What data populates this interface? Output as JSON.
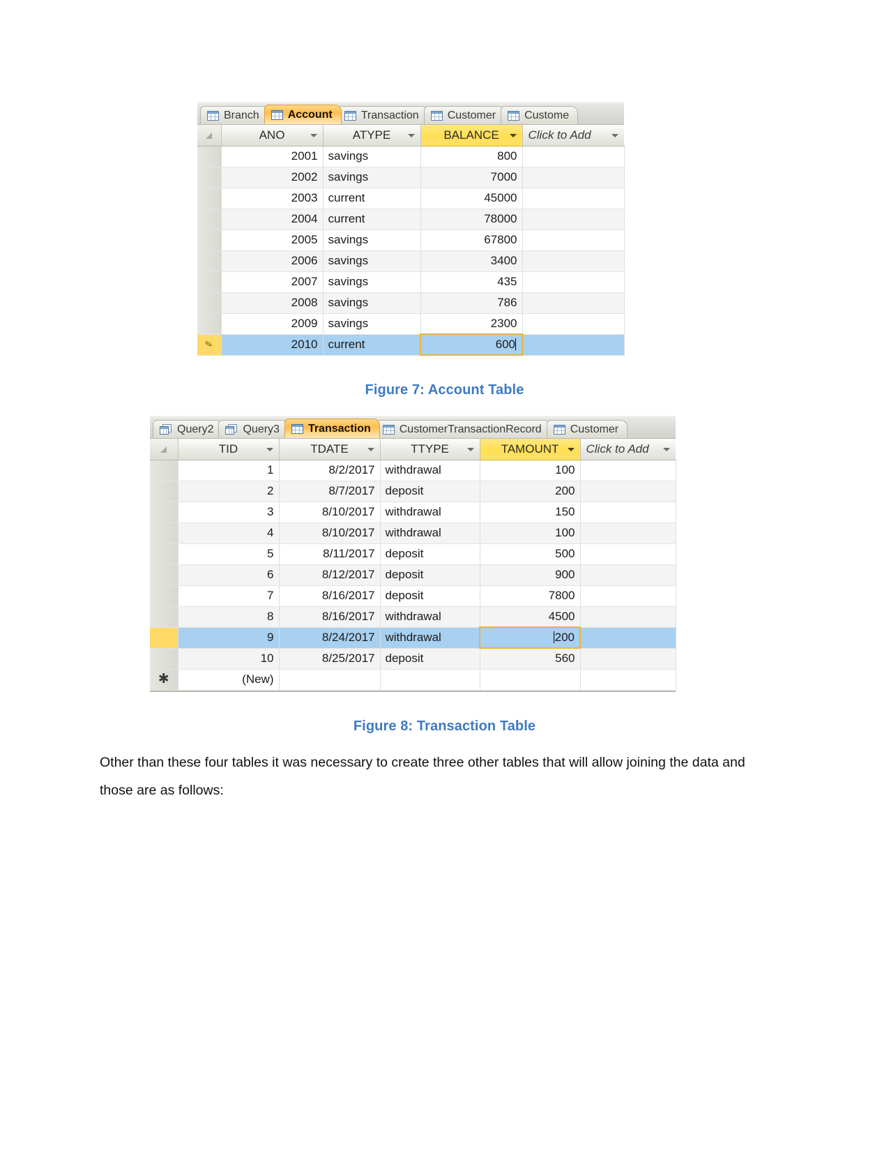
{
  "document": {
    "figure7_caption": "Figure 7: Account Table",
    "figure8_caption": "Figure 8: Transaction Table",
    "paragraph": "Other than these four tables it was necessary to create three other tables that will allow joining the data and those are as follows:",
    "caption_color": "#3f7ac0"
  },
  "account_screenshot": {
    "tabs": [
      {
        "label": "Branch",
        "icon": "table-icon",
        "active": false
      },
      {
        "label": "Account",
        "icon": "table-icon",
        "active": true
      },
      {
        "label": "Transaction",
        "icon": "table-icon",
        "active": false
      },
      {
        "label": "Customer",
        "icon": "table-icon",
        "active": false
      },
      {
        "label": "Custome",
        "icon": "table-icon",
        "active": false
      }
    ],
    "columns": [
      "ANO",
      "ATYPE",
      "BALANCE"
    ],
    "highlighted_column": "BALANCE",
    "add_column_label": "Click to Add",
    "rows": [
      {
        "ANO": "2001",
        "ATYPE": "savings",
        "BALANCE": "800"
      },
      {
        "ANO": "2002",
        "ATYPE": "savings",
        "BALANCE": "7000"
      },
      {
        "ANO": "2003",
        "ATYPE": "current",
        "BALANCE": "45000"
      },
      {
        "ANO": "2004",
        "ATYPE": "current",
        "BALANCE": "78000"
      },
      {
        "ANO": "2005",
        "ATYPE": "savings",
        "BALANCE": "67800"
      },
      {
        "ANO": "2006",
        "ATYPE": "savings",
        "BALANCE": "3400"
      },
      {
        "ANO": "2007",
        "ATYPE": "savings",
        "BALANCE": "435"
      },
      {
        "ANO": "2008",
        "ATYPE": "savings",
        "BALANCE": "786"
      },
      {
        "ANO": "2009",
        "ATYPE": "savings",
        "BALANCE": "2300"
      },
      {
        "ANO": "2010",
        "ATYPE": "current",
        "BALANCE": "600"
      }
    ],
    "selected_row_index": 9,
    "editing_cell": {
      "row": 9,
      "column": "BALANCE",
      "value": "600"
    },
    "record_indicator": "pencil-icon"
  },
  "transaction_screenshot": {
    "tabs": [
      {
        "label": "Query2",
        "icon": "query-icon",
        "active": false
      },
      {
        "label": "Query3",
        "icon": "query-icon",
        "active": false
      },
      {
        "label": "Transaction",
        "icon": "table-icon",
        "active": true
      },
      {
        "label": "CustomerTransactionRecord",
        "icon": "table-icon",
        "active": false
      },
      {
        "label": "Customer",
        "icon": "table-icon",
        "active": false
      }
    ],
    "columns": [
      "TID",
      "TDATE",
      "TTYPE",
      "TAMOUNT"
    ],
    "highlighted_column": "TAMOUNT",
    "add_column_label": "Click to Add",
    "new_row_label": "(New)",
    "rows": [
      {
        "TID": "1",
        "TDATE": "8/2/2017",
        "TTYPE": "withdrawal",
        "TAMOUNT": "100"
      },
      {
        "TID": "2",
        "TDATE": "8/7/2017",
        "TTYPE": "deposit",
        "TAMOUNT": "200"
      },
      {
        "TID": "3",
        "TDATE": "8/10/2017",
        "TTYPE": "withdrawal",
        "TAMOUNT": "150"
      },
      {
        "TID": "4",
        "TDATE": "8/10/2017",
        "TTYPE": "withdrawal",
        "TAMOUNT": "100"
      },
      {
        "TID": "5",
        "TDATE": "8/11/2017",
        "TTYPE": "deposit",
        "TAMOUNT": "500"
      },
      {
        "TID": "6",
        "TDATE": "8/12/2017",
        "TTYPE": "deposit",
        "TAMOUNT": "900"
      },
      {
        "TID": "7",
        "TDATE": "8/16/2017",
        "TTYPE": "deposit",
        "TAMOUNT": "7800"
      },
      {
        "TID": "8",
        "TDATE": "8/16/2017",
        "TTYPE": "withdrawal",
        "TAMOUNT": "4500"
      },
      {
        "TID": "9",
        "TDATE": "8/24/2017",
        "TTYPE": "withdrawal",
        "TAMOUNT": "200"
      },
      {
        "TID": "10",
        "TDATE": "8/25/2017",
        "TTYPE": "deposit",
        "TAMOUNT": "560"
      }
    ],
    "selected_row_index": 8,
    "editing_cell": {
      "row": 8,
      "column": "TAMOUNT",
      "value": "200"
    },
    "new_record_indicator": "asterisk-icon"
  }
}
